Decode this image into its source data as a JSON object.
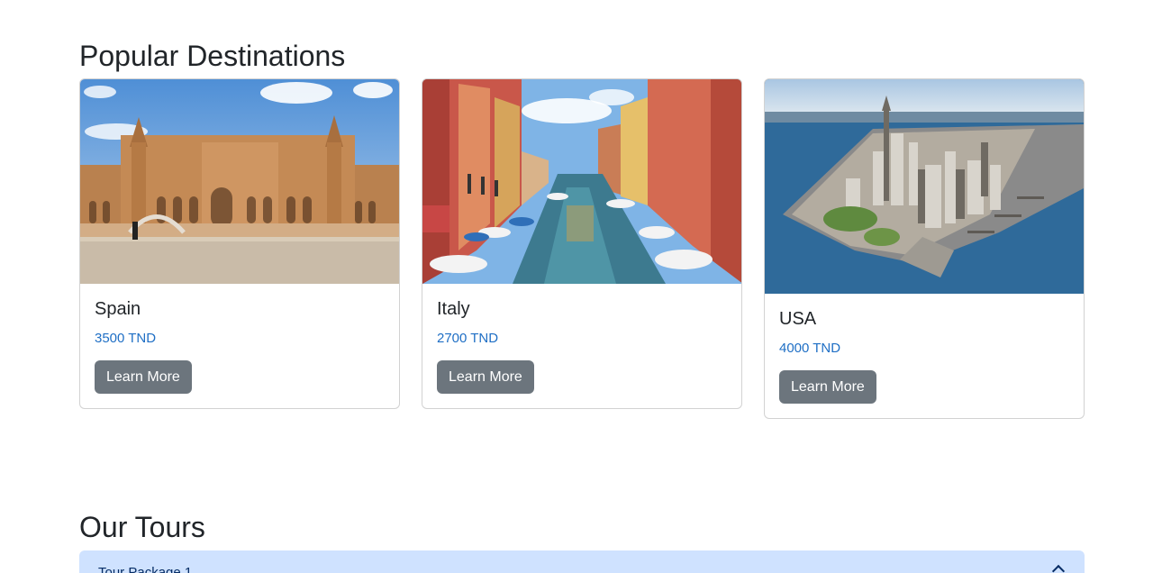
{
  "sections": {
    "destinations_title": "Popular Destinations",
    "tours_title": "Our Tours"
  },
  "destinations": [
    {
      "name": "Spain",
      "price": "3500 TND",
      "button": "Learn More",
      "image": "plaza-de-espana-photo"
    },
    {
      "name": "Italy",
      "price": "2700 TND",
      "button": "Learn More",
      "image": "burano-canal-photo"
    },
    {
      "name": "USA",
      "price": "4000 TND",
      "button": "Learn More",
      "image": "manhattan-aerial-photo"
    }
  ],
  "accordion": {
    "first_item_label": "Tour Package 1"
  },
  "colors": {
    "price": "#1f6fc5",
    "button_bg": "#6c757d",
    "accordion_bg": "#cfe2ff"
  }
}
